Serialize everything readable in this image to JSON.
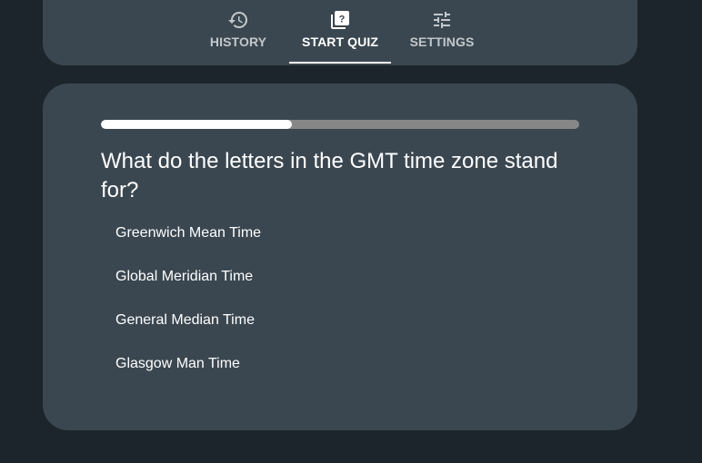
{
  "nav": {
    "tabs": [
      {
        "label": "HISTORY",
        "icon": "history-icon",
        "active": false
      },
      {
        "label": "START QUIZ",
        "icon": "quiz-icon",
        "active": true
      },
      {
        "label": "SETTINGS",
        "icon": "tune-icon",
        "active": false
      }
    ]
  },
  "quiz": {
    "progress": 0.4,
    "question": "What do the letters in the GMT time zone stand for?",
    "answers": [
      "Greenwich Mean Time",
      "Global Meridian Time",
      "General Median Time",
      "Glasgow Man Time"
    ]
  },
  "colors": {
    "background": "#1b252b",
    "card": "#3b4750",
    "text": "#ffffff",
    "muted": "#c2c8cc",
    "progress_track": "#878787",
    "progress_fill": "#ffffff"
  }
}
